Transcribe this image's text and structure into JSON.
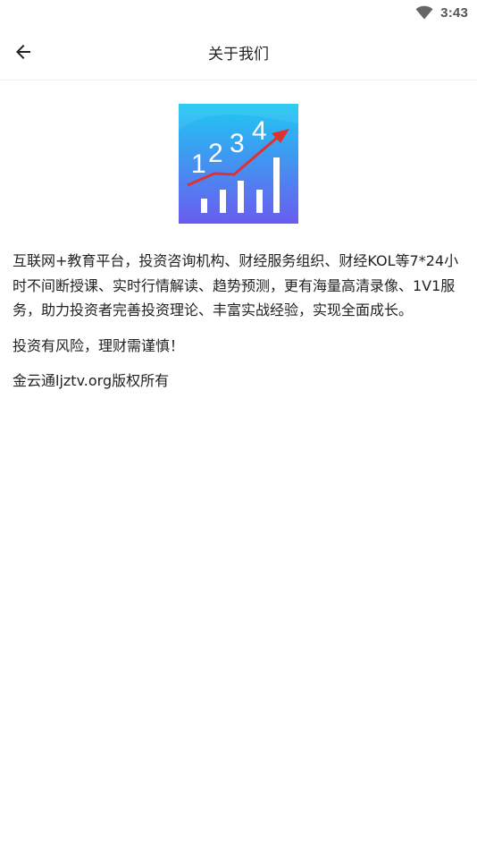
{
  "status": {
    "time": "3:43",
    "wifi_icon": "wifi-icon"
  },
  "header": {
    "title": "关于我们",
    "back_icon": "arrow-left-icon"
  },
  "logo": {
    "digits": [
      "1",
      "2",
      "3",
      "4"
    ],
    "colors": {
      "top": "#1ec8f2",
      "bottom": "#6a5cf0",
      "arrow": "#e0312f"
    }
  },
  "about": {
    "description": "互联网+教育平台，投资咨询机构、财经服务组织、财经KOL等7*24小时不间断授课、实时行情解读、趋势预测，更有海量高清录像、1V1服务，助力投资者完善投资理论、丰富实战经验，实现全面成长。",
    "risk_warning": "投资有风险，理财需谨慎！",
    "copyright": "金云通ljztv.org版权所有"
  }
}
